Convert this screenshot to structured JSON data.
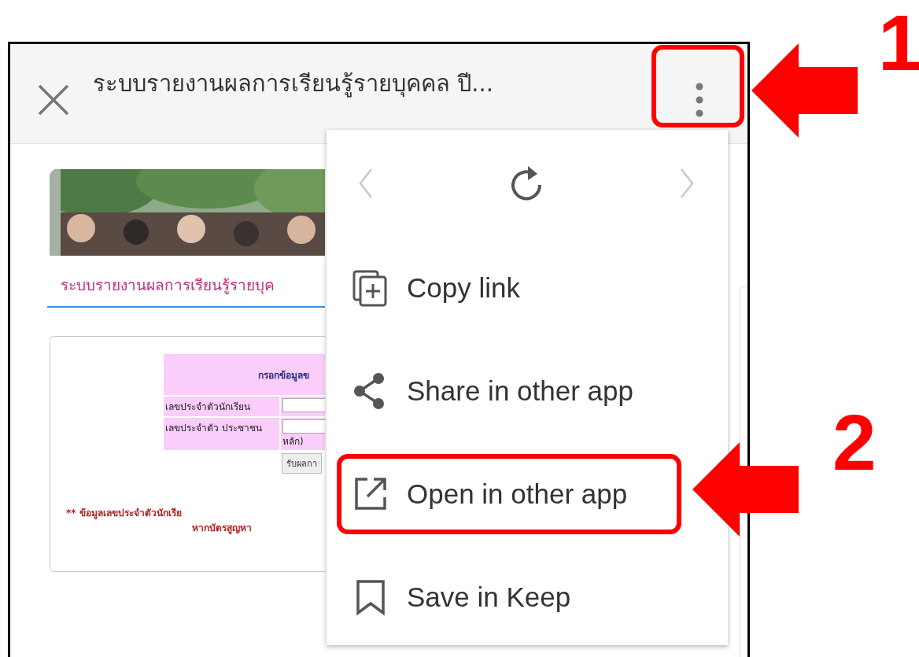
{
  "toolbar": {
    "title": "ระบบรายงานผลการเรียนรู้รายบุคคล ปี...",
    "menu_button": {
      "callout": "1"
    }
  },
  "page": {
    "heading": "ระบบรายงานผลการเรียนรู้รายบุค",
    "form": {
      "header": "กรอกข้อมูลข",
      "fields": [
        {
          "label": "เลขประจำตัวนักเรียน"
        },
        {
          "label": "เลขประจำตัว ประชาชน",
          "note": "หลัก)"
        }
      ],
      "submit": "รับผลกา",
      "notes": [
        "** ข้อมูลเลขประจำตัวนักเรีย",
        "หากบัตรสูญหา"
      ]
    }
  },
  "menu": {
    "nav": {
      "back_disabled": true,
      "forward_disabled": true
    },
    "items": [
      {
        "label": "Copy link"
      },
      {
        "label": "Share in other app"
      },
      {
        "label": "Open in other app",
        "callout": "2"
      },
      {
        "label": "Save in Keep"
      }
    ]
  }
}
